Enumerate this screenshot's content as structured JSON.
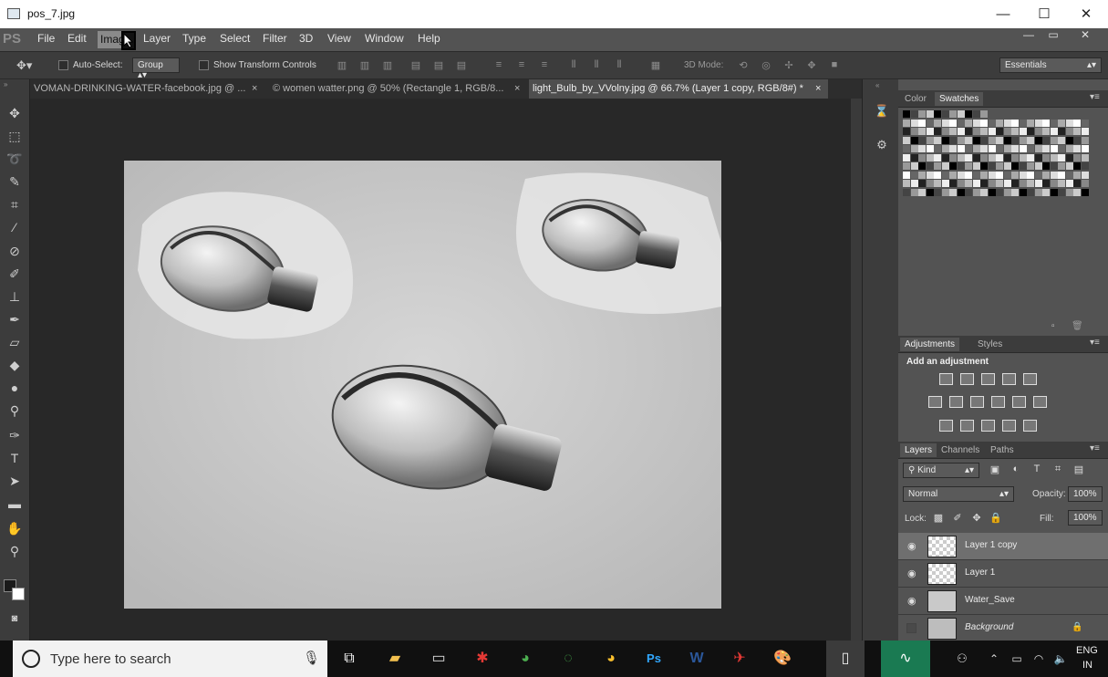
{
  "window": {
    "title": "pos_7.jpg",
    "minimize": "—",
    "maximize": "☐",
    "close": "✕"
  },
  "menubar": {
    "logo": "PS",
    "items": [
      "File",
      "Edit",
      "Image",
      "Layer",
      "Type",
      "Select",
      "Filter",
      "3D",
      "View",
      "Window",
      "Help"
    ],
    "active_item": "Image",
    "controls": [
      "—",
      "▭",
      "✕"
    ]
  },
  "options": {
    "auto_select_label": "Auto-Select:",
    "auto_select_value": "Group",
    "show_transform_label": "Show Transform Controls",
    "mode_label": "3D Mode:",
    "workspace": "Essentials"
  },
  "tabs": [
    {
      "label": "VOMAN-DRINKING-WATER-facebook.jpg @ ...",
      "close": "×"
    },
    {
      "label": "© women watter.png @ 50% (Rectangle 1, RGB/8...",
      "close": "×"
    },
    {
      "label": "light_Bulb_by_VVolny.jpg @ 66.7% (Layer 1 copy, RGB/8#) *",
      "close": "×",
      "active": true
    }
  ],
  "swatches_panel": {
    "tabs": [
      "Color",
      "Swatches"
    ],
    "active_tab": "Swatches"
  },
  "adjustments_panel": {
    "tabs": [
      "Adjustments",
      "Styles"
    ],
    "active_tab": "Adjustments",
    "heading": "Add an adjustment"
  },
  "layers_panel": {
    "tabs": [
      "Layers",
      "Channels",
      "Paths"
    ],
    "active_tab": "Layers",
    "filter_kind": "Kind",
    "blend_mode": "Normal",
    "opacity_label": "Opacity:",
    "opacity_value": "100%",
    "lock_label": "Lock:",
    "fill_label": "Fill:",
    "fill_value": "100%",
    "layers": [
      {
        "name": "Layer 1 copy",
        "visible": true,
        "selected": true
      },
      {
        "name": "Layer 1",
        "visible": true,
        "selected": false
      },
      {
        "name": "Water_Save",
        "visible": true,
        "selected": false
      },
      {
        "name": "Background",
        "visible": false,
        "selected": false,
        "locked": true
      }
    ]
  },
  "taskbar": {
    "search_placeholder": "Type here to search",
    "language": "ENG",
    "region": "IN"
  },
  "colors": {
    "ps_dark": "#282828",
    "ps_panel": "#535353",
    "ps_menu": "#535353"
  }
}
